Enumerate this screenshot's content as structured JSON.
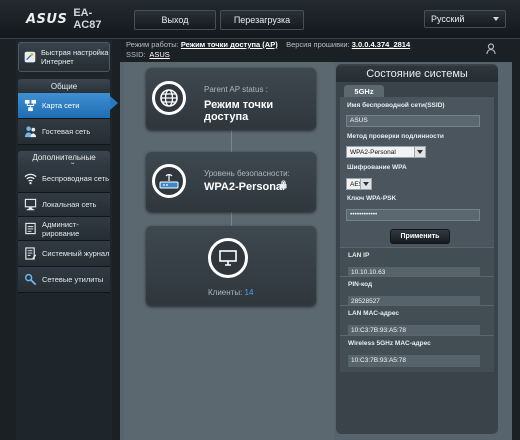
{
  "header": {
    "brand_logo": "ASUS",
    "model": "EA-AC87",
    "logout_label": "Выход",
    "reboot_label": "Перезагрузка",
    "language": "Русский"
  },
  "mode_bar": {
    "mode_label": "Режим работы:",
    "mode_value": "Режим точки доступа (AP)",
    "firmware_label": "Версия прошивки:",
    "firmware_value": "3.0.0.4.374_2814",
    "ssid_label": "SSID:",
    "ssid_value": "ASUS"
  },
  "sidebar": {
    "quick_setup": "Быстрая настройка Интернет",
    "general_header": "Общие",
    "general_items": [
      {
        "label": "Карта сети",
        "icon": "network-map-icon",
        "active": true
      },
      {
        "label": "Гостевая сеть",
        "icon": "guest-network-icon",
        "active": false
      }
    ],
    "advanced_header": "Дополнительные настройки",
    "advanced_items": [
      {
        "label": "Беспроводная сеть",
        "icon": "wireless-icon"
      },
      {
        "label": "Локальная сеть",
        "icon": "lan-icon"
      },
      {
        "label": "Админист-рирование",
        "icon": "administration-icon"
      },
      {
        "label": "Системный журнал",
        "icon": "system-log-icon"
      },
      {
        "label": "Сетевые утилиты",
        "icon": "network-tools-icon"
      }
    ]
  },
  "network_map": {
    "parent_label": "Parent AP status :",
    "parent_value": "Режим точки доступа",
    "security_label": "Уровень безопасности:",
    "security_value": "WPA2-Personal",
    "clients_label": "Клиенты:",
    "clients_value": "14"
  },
  "status_panel": {
    "title": "Состояние системы",
    "tab": "5GHz",
    "ssid_label": "Имя беспроводной сети(SSID)",
    "ssid_value": "ASUS",
    "auth_label": "Метод проверки подлинности",
    "auth_value": "WPA2-Personal",
    "enc_label": "Шифрование WPA",
    "enc_value": "AES",
    "psk_label": "Ключ WPA-PSK",
    "psk_value": "••••••••••••",
    "apply_label": "Применить",
    "lan_ip_label": "LAN IP",
    "lan_ip_value": "10.10.10.63",
    "pin_label": "PIN-код",
    "pin_value": "28528527",
    "lan_mac_label": "LAN MAC-адрес",
    "lan_mac_value": "10:C3:7B:93:A5:78",
    "wl_mac_label": "Wireless 5GHz MAC-адрес",
    "wl_mac_value": "10:C3:7B:93:A5:78"
  },
  "colors": {
    "accent": "#2a79c0",
    "background": "#1b2024",
    "main_area": "#58646d",
    "client_count": "#4aa3e8"
  }
}
